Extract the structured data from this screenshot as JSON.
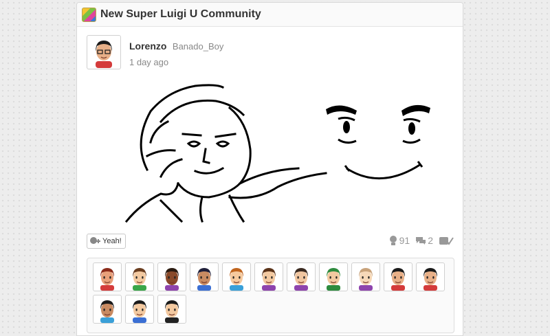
{
  "community": {
    "title": "New Super Luigi U Community",
    "icon": "game-icon"
  },
  "post": {
    "author_name": "Lorenzo",
    "author_handle": "Banado_Boy",
    "time": "1 day ago",
    "drawing": "handwritten-drawing"
  },
  "actions": {
    "yeah_label": "Yeah!",
    "yeah_count": "91",
    "comment_count": "2"
  },
  "empathy_miis": [
    {
      "skin": "#e8a07a",
      "hair": "#8b2b1a",
      "shirt": "#d43b3b"
    },
    {
      "skin": "#f3c9a0",
      "hair": "#6a3d1f",
      "shirt": "#3aa64a"
    },
    {
      "skin": "#8a4a2a",
      "hair": "#2a1a10",
      "shirt": "#8e44ad"
    },
    {
      "skin": "#c98b62",
      "hair": "#1f1f3a",
      "shirt": "#3b6fd4"
    },
    {
      "skin": "#f6c99d",
      "hair": "#c0641e",
      "shirt": "#3aa0d8"
    },
    {
      "skin": "#f3c9a0",
      "hair": "#5a3218",
      "shirt": "#8e44ad"
    },
    {
      "skin": "#f1c6a0",
      "hair": "#3a2a20",
      "shirt": "#8e44ad"
    },
    {
      "skin": "#f3c9a0",
      "hair": "#2e8b3e",
      "shirt": "#2e8b3e"
    },
    {
      "skin": "#f6d8b8",
      "hair": "#c8a27a",
      "shirt": "#8e44ad"
    },
    {
      "skin": "#e8b088",
      "hair": "#1a1a1a",
      "shirt": "#d43b3b"
    },
    {
      "skin": "#e8b088",
      "hair": "#1a1a1a",
      "shirt": "#d43b3b"
    },
    {
      "skin": "#c98b62",
      "hair": "#1a1a1a",
      "shirt": "#3aa0d8"
    },
    {
      "skin": "#f3c9a0",
      "hair": "#1a1a1a",
      "shirt": "#3b6fd4"
    },
    {
      "skin": "#f3c9a0",
      "hair": "#1a1a1a",
      "shirt": "#222222"
    }
  ]
}
